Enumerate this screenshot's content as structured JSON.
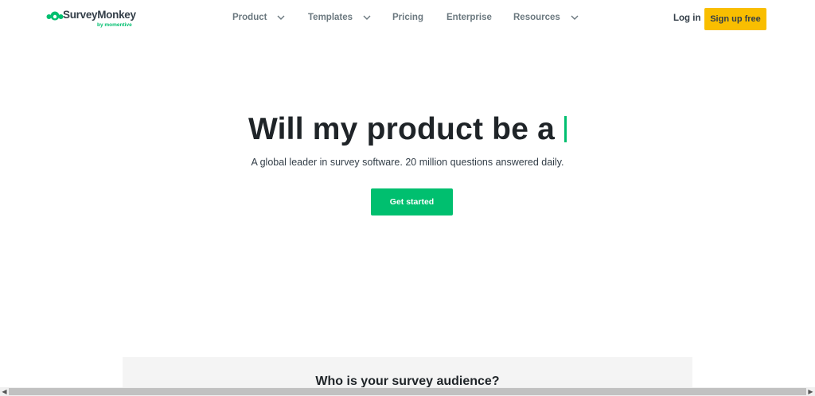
{
  "header": {
    "logo_text": "SurveyMonkey",
    "logo_sub": "by momentive",
    "nav": [
      {
        "label": "Product",
        "has_dropdown": true
      },
      {
        "label": "Templates",
        "has_dropdown": true
      },
      {
        "label": "Pricing",
        "has_dropdown": false
      },
      {
        "label": "Enterprise",
        "has_dropdown": false
      },
      {
        "label": "Resources",
        "has_dropdown": true
      }
    ],
    "login_label": "Log in",
    "signup_label": "Sign up free"
  },
  "hero": {
    "title": "Will my product be a",
    "subtitle": "A global leader in survey software. 20 million questions answered daily.",
    "cta_label": "Get started"
  },
  "section": {
    "title": "Who is your survey audience?"
  },
  "colors": {
    "brand_green": "#00bf6f",
    "signup_yellow": "#f9be00",
    "text_dark": "#333e48",
    "nav_gray": "#6b787f"
  }
}
